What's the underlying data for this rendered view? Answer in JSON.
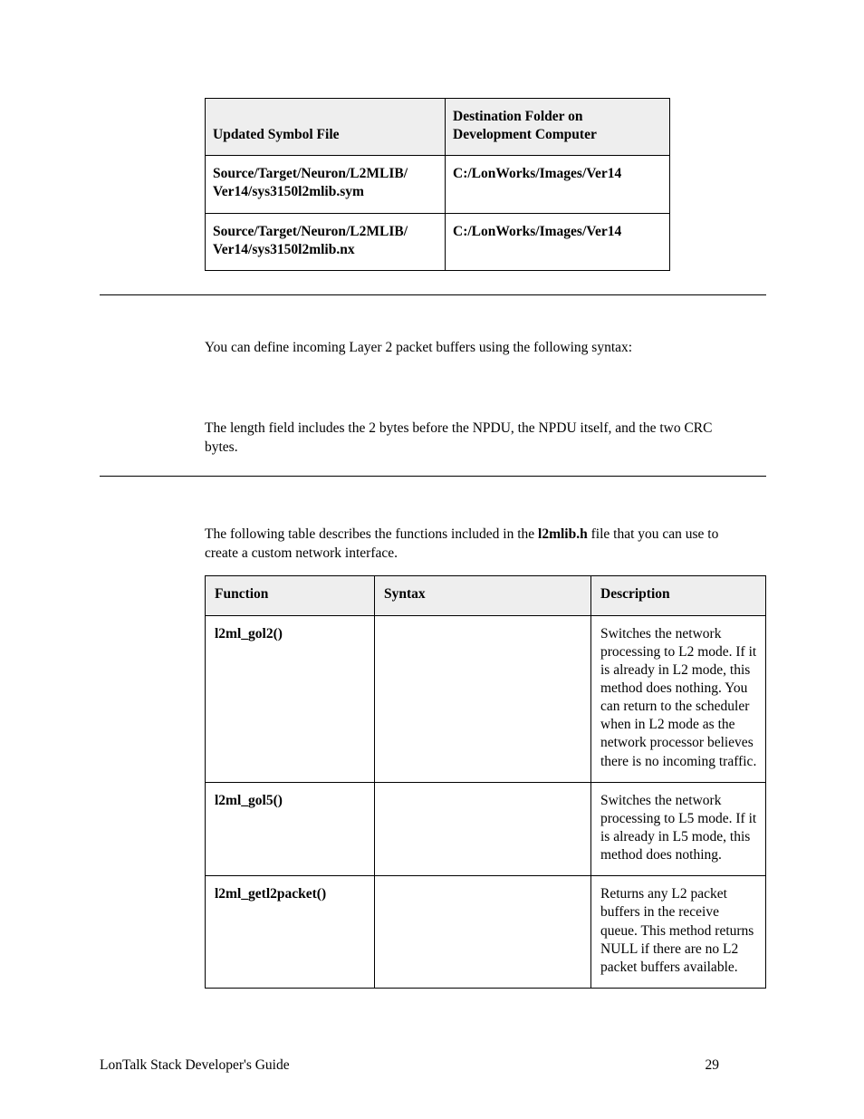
{
  "table1": {
    "headers": [
      "Updated Symbol File",
      "Destination Folder on Development Computer"
    ],
    "rows": [
      [
        "Source/Target/Neuron/L2MLIB/ Ver14/sys3150l2mlib.sym",
        "C:/LonWorks/Images/Ver14"
      ],
      [
        "Source/Target/Neuron/L2MLIB/ Ver14/sys3150l2mlib.nx",
        "C:/LonWorks/Images/Ver14"
      ]
    ]
  },
  "para1": "You can define incoming Layer 2 packet buffers using the following syntax:",
  "para2": "The length field includes the 2 bytes before the NPDU, the NPDU itself, and the two CRC bytes.",
  "para3a": "The following table describes the functions included in the ",
  "para3b": "l2mlib.h",
  "para3c": " file that you can use to create a custom network interface.",
  "table2": {
    "headers": [
      "Function",
      "Syntax",
      "Description"
    ],
    "rows": [
      {
        "fn": "l2ml_gol2()",
        "syntax": "",
        "desc": "Switches the network processing to L2 mode.  If it is already in L2 mode, this method does nothing.  You can return to the scheduler when in L2 mode as the network processor believes there is no incoming traffic."
      },
      {
        "fn": "l2ml_gol5()",
        "syntax": "",
        "desc": "Switches the network processing to L5 mode.  If it is already in L5 mode, this method does nothing."
      },
      {
        "fn": "l2ml_getl2packet()",
        "syntax": "",
        "desc": "Returns any L2 packet buffers in the receive queue.  This method returns NULL if there are no L2 packet buffers available."
      }
    ]
  },
  "footer": {
    "title": "LonTalk Stack Developer's Guide",
    "page": "29"
  }
}
